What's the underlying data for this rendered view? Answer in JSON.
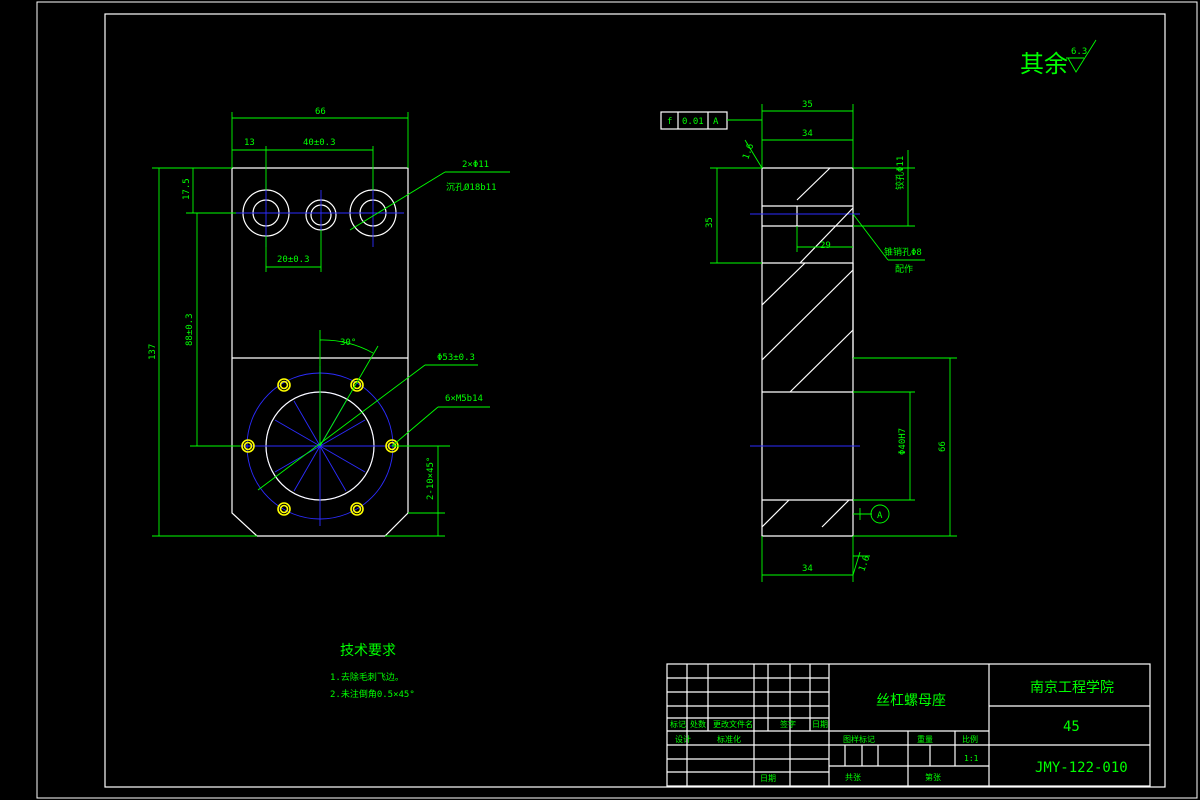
{
  "roughness_note": "其余",
  "roughness_value": "6.3",
  "front_view": {
    "dim_overall_width": "66",
    "dim_left_offset": "13",
    "dim_hole_spacing": "40±0.3",
    "dim_center_spacing": "20±0.3",
    "dim_top_offset": "17.5",
    "dim_height": "137",
    "dim_center_height": "88±0.3",
    "dim_angle": "30°",
    "dim_bolt_circle": "Φ53±0.3",
    "note_threaded_holes": "6×M5b14",
    "note_holes_qty": "2×Φ11",
    "note_counterbore": "沉孔Ø18b11",
    "note_chamfer": "2-10×45°"
  },
  "side_view": {
    "tol_symbol": "f",
    "tol_value": "0.01",
    "tol_datum": "A",
    "dim_total_width": "35",
    "dim_body_width": "34",
    "dim_bottom_width": "34",
    "dim_upper_depth": "35",
    "dim_small_hole": "铰孔Φ11",
    "dim_hole_depth": "29",
    "note_taper": "锥销孔Φ8",
    "note_assembly": "配作",
    "dim_bore": "Φ40H7",
    "dim_lower_height": "66",
    "dim_slope_top": "1.6",
    "dim_slope_bottom": "1.6",
    "datum_label": "A"
  },
  "tech_requirements": {
    "title": "技术要求",
    "items": [
      "1.去除毛刺飞边。",
      "2.未注倒角0.5×45°"
    ]
  },
  "title_block": {
    "part_name": "丝杠螺母座",
    "school": "南京工程学院",
    "material": "45",
    "drawing_no": "JMY-122-010",
    "scale": "1:1",
    "hdr_mark": "标记",
    "hdr_count": "处数",
    "hdr_doc": "更改文件名",
    "hdr_sign": "签字",
    "hdr_date": "日期",
    "hdr_design": "设计",
    "hdr_standard": "标准化",
    "hdr_stage": "图样标记",
    "hdr_weight": "重量",
    "hdr_scale": "比例",
    "hdr_date2": "日期",
    "hdr_sheets": "共张",
    "hdr_sheet_no": "第张"
  }
}
